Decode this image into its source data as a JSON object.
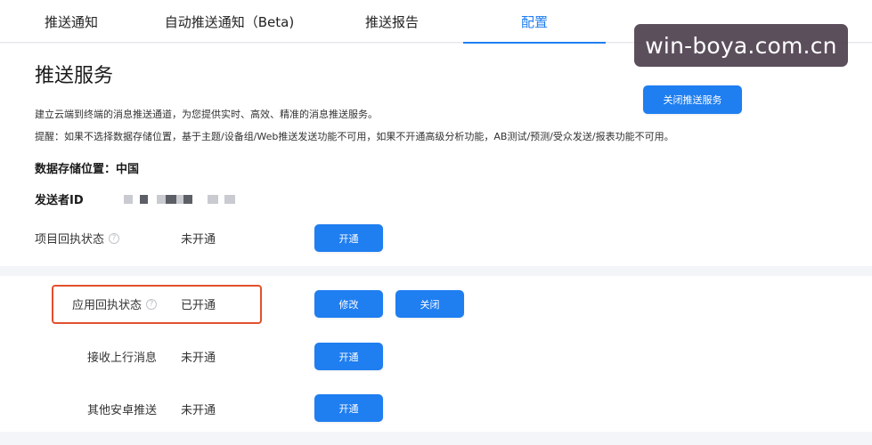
{
  "tabs": [
    {
      "label": "推送通知"
    },
    {
      "label": "自动推送通知（Beta)"
    },
    {
      "label": "推送报告"
    },
    {
      "label": "配置"
    }
  ],
  "watermark": "win-boya.com.cn",
  "service": {
    "title": "推送服务",
    "close_button": "关闭推送服务",
    "description": "建立云端到终端的消息推送通道，为您提供实时、高效、精准的消息推送服务。",
    "note": "提醒：如果不选择数据存储位置，基于主题/设备组/Web推送发送功能不可用，如果不开通高级分析功能，AB测试/预测/受众发送/报表功能不可用。",
    "storage_location": "数据存储位置：中国",
    "sender_id_label": "发送者ID"
  },
  "rows": {
    "project_receipt": {
      "label": "项目回执状态",
      "value": "未开通",
      "button": "开通"
    },
    "app_receipt": {
      "label": "应用回执状态",
      "value": "已开通",
      "modify_button": "修改",
      "close_button": "关闭"
    },
    "upstream": {
      "label": "接收上行消息",
      "value": "未开通",
      "button": "开通"
    },
    "other_android": {
      "label": "其他安卓推送",
      "value": "未开通",
      "button": "开通"
    }
  },
  "colors": {
    "accent": "#1f7ef0",
    "highlight": "#e2502d"
  }
}
